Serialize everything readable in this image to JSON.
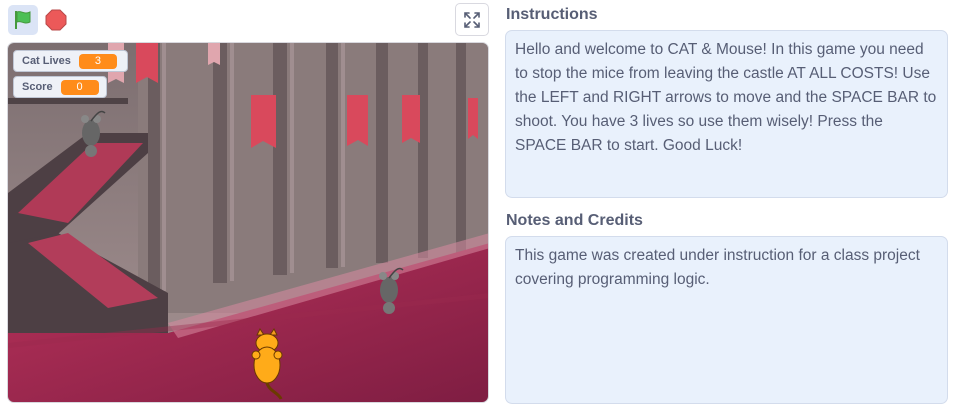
{
  "controls": {
    "green_flag_icon": "green-flag-icon",
    "stop_icon": "stop-sign-icon",
    "fullscreen_icon": "fullscreen-icon"
  },
  "stage": {
    "monitors": [
      {
        "label": "Cat Lives",
        "value": "3"
      },
      {
        "label": "Score",
        "value": "0"
      }
    ],
    "sprites": [
      "cat",
      "mouse",
      "mouse"
    ]
  },
  "instructions": {
    "title": "Instructions",
    "text": "Hello and welcome to CAT & Mouse! In this game you need to stop the mice from leaving the castle AT ALL COSTS! Use the LEFT and RIGHT arrows to move and the SPACE BAR to shoot. You have 3 lives so use them wisely! Press the SPACE BAR to start. Good Luck!"
  },
  "notes": {
    "title": "Notes and Credits",
    "text": "This game was created under instruction for a class project covering programming logic."
  },
  "colors": {
    "accent_orange": "#ff8c1a",
    "panel_bg": "#e9f1fc",
    "text": "#575e75"
  }
}
